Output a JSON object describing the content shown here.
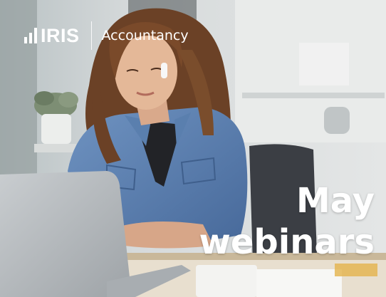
{
  "logo": {
    "brand": "IRIS",
    "product": "Accountancy"
  },
  "headline": {
    "line1": "May",
    "line2": "webinars"
  },
  "colors": {
    "text": "#ffffff",
    "shirt": "#5a7fae",
    "hair": "#6b4126",
    "chair": "#3b3e44"
  },
  "icons": {
    "logo_mark": "signal-bars-icon"
  }
}
